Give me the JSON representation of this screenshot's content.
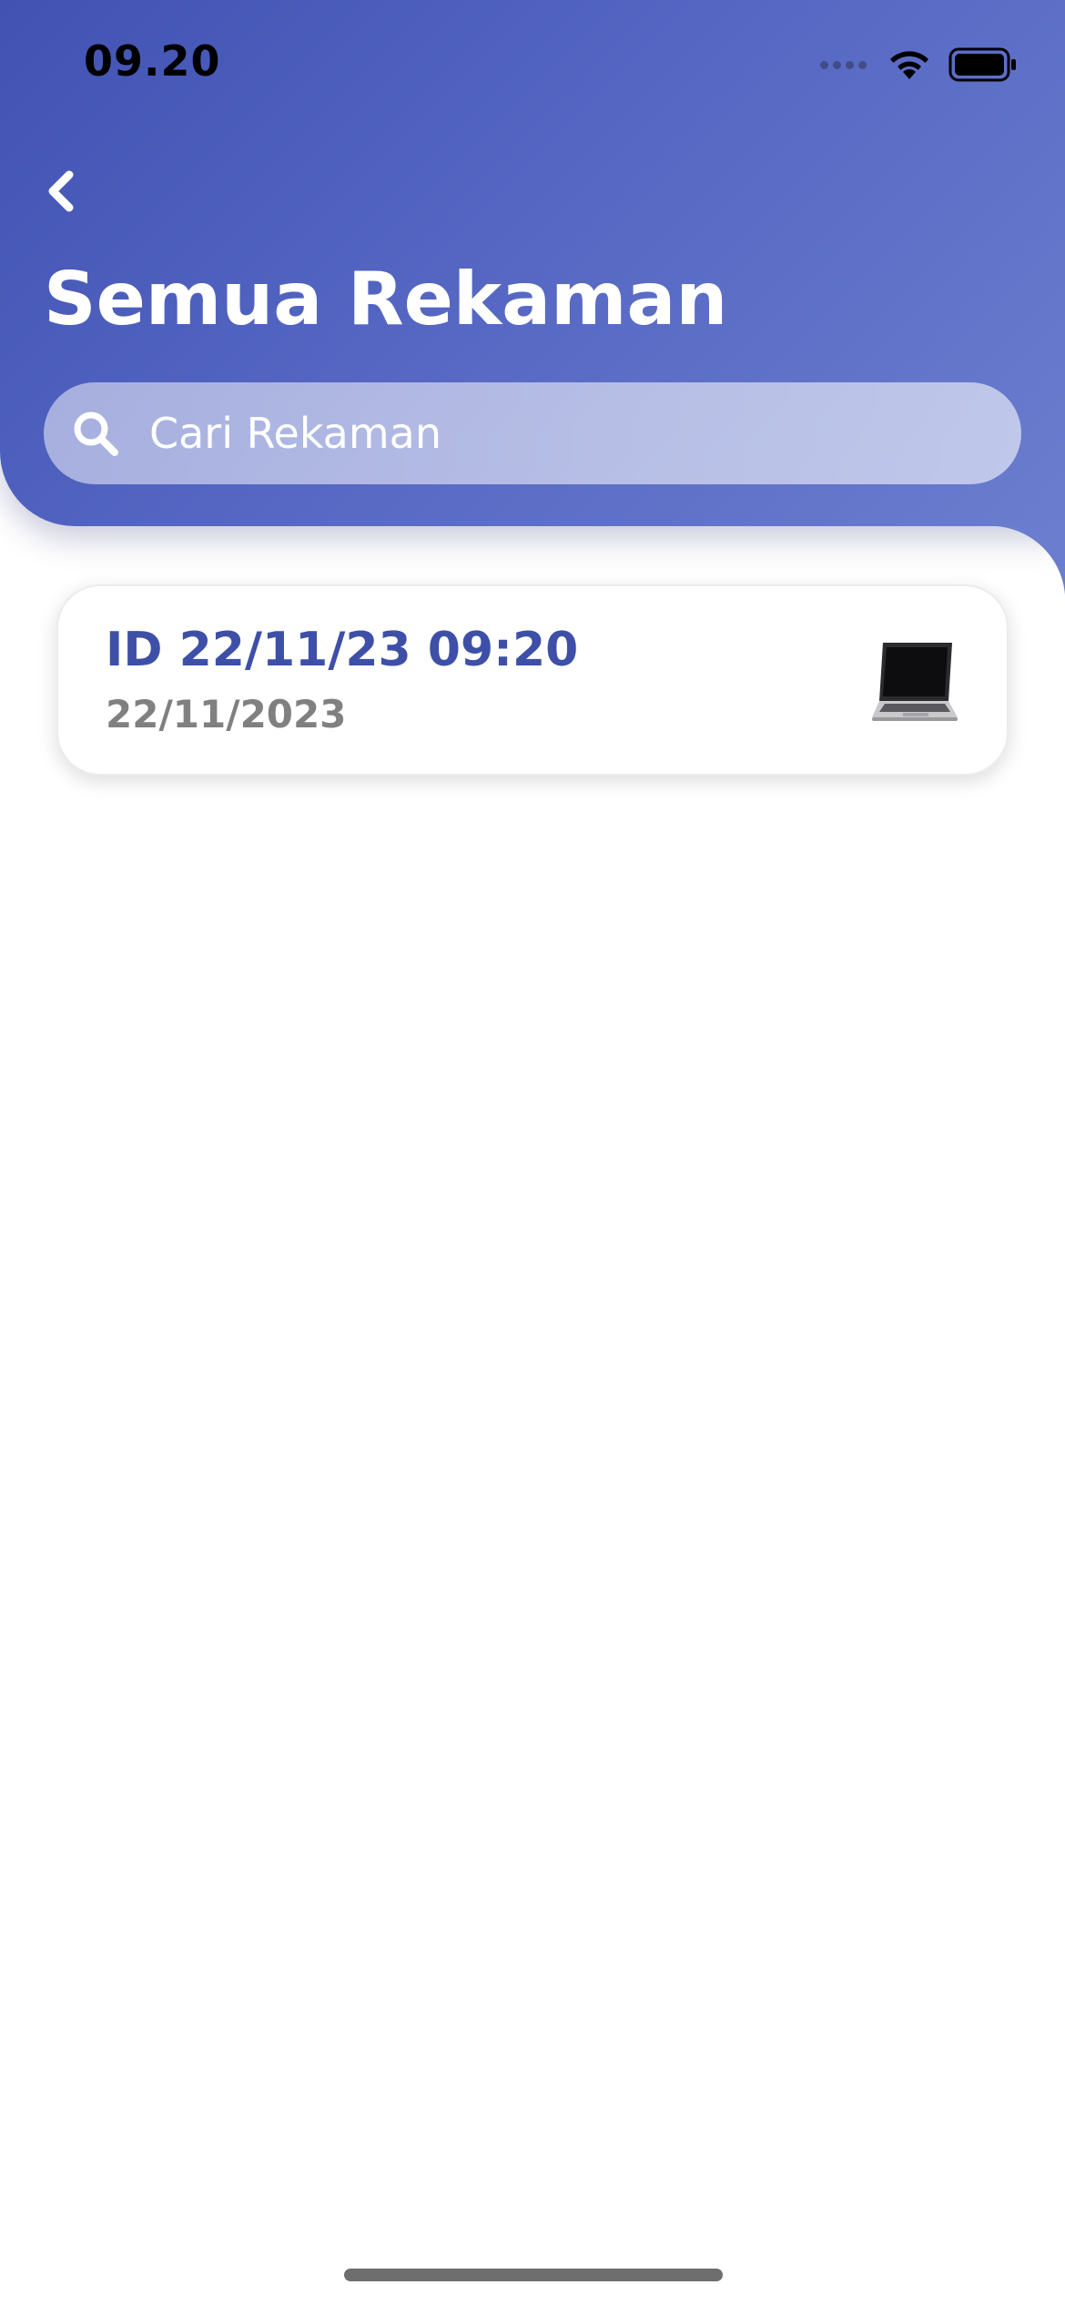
{
  "status_bar": {
    "time": "09.20",
    "icons": [
      "signal-dots-icon",
      "wifi-icon",
      "battery-icon"
    ]
  },
  "header": {
    "back_icon": "chevron-left-icon",
    "title": "Semua Rekaman",
    "gradient_colors": [
      "#4152b3",
      "#6a7dce"
    ]
  },
  "search": {
    "icon": "search-icon",
    "placeholder": "Cari Rekaman",
    "value": ""
  },
  "records": [
    {
      "title": "ID 22/11/23 09:20",
      "date": "22/11/2023",
      "icon": "laptop-icon"
    }
  ],
  "colors": {
    "title_text": "#3e4fa8",
    "date_text": "#808080"
  }
}
